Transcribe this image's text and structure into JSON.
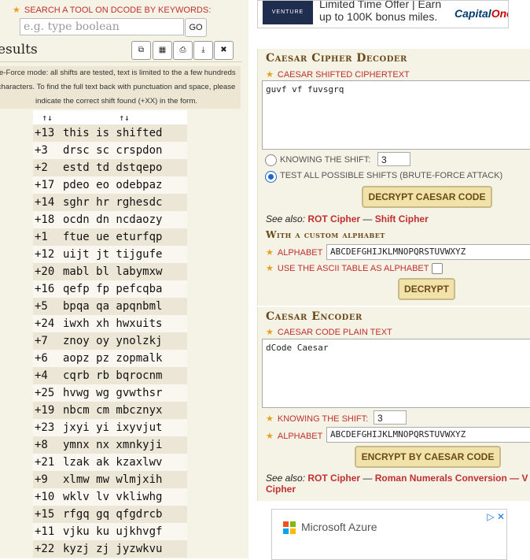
{
  "search": {
    "label": "Search a tool on dCode by keywords:",
    "placeholder": "e.g. type boolean",
    "go_label": "GO"
  },
  "results": {
    "title": "esults",
    "toolbar_icons": [
      "copy-icon",
      "calculator-icon",
      "print-icon",
      "download-icon",
      "close-icon"
    ],
    "toolbar_glyphs": [
      "⧉",
      "▦",
      "⎙",
      "⤓",
      "✖"
    ],
    "note_lines": [
      "te-Force mode: all shifts are tested, text is limited to the a few hundreds",
      "characters. To find the full text back with punctuation and space, please",
      "indicate the correct shift found (+XX) in the form."
    ],
    "sort_header": "↑↓",
    "rows": [
      {
        "shift": "+13",
        "text": "this is shifted"
      },
      {
        "shift": "+3",
        "text": "drsc sc crspdon"
      },
      {
        "shift": "+2",
        "text": "estd td dstqepo"
      },
      {
        "shift": "+17",
        "text": "pdeo eo odebpaz"
      },
      {
        "shift": "+14",
        "text": "sghr hr rghesdc"
      },
      {
        "shift": "+18",
        "text": "ocdn dn ncdaozy"
      },
      {
        "shift": "+1",
        "text": "ftue ue eturfqp"
      },
      {
        "shift": "+12",
        "text": "uijt jt tijgufe"
      },
      {
        "shift": "+20",
        "text": "mabl bl labymxw"
      },
      {
        "shift": "+16",
        "text": "qefp fp pefcqba"
      },
      {
        "shift": "+5",
        "text": "bpqa qa apqnbml"
      },
      {
        "shift": "+24",
        "text": "iwxh xh hwxuits"
      },
      {
        "shift": "+7",
        "text": "znoy oy ynolzkj"
      },
      {
        "shift": "+6",
        "text": "aopz pz zopmalk"
      },
      {
        "shift": "+4",
        "text": "cqrb rb bqrocnm"
      },
      {
        "shift": "+25",
        "text": "hvwg wg gvwthsr"
      },
      {
        "shift": "+19",
        "text": "nbcm cm mbcznyx"
      },
      {
        "shift": "+23",
        "text": "jxyi yi ixyvjut"
      },
      {
        "shift": "+8",
        "text": "ymnx nx xmnkyji"
      },
      {
        "shift": "+21",
        "text": "lzak ak kzaxlwv"
      },
      {
        "shift": "+9",
        "text": "xlmw mw wlmjxih"
      },
      {
        "shift": "+10",
        "text": "wklv lv vkliwhg"
      },
      {
        "shift": "+15",
        "text": "rfgq gq qfgdrcb"
      },
      {
        "shift": "+11",
        "text": "vjku ku ujkhvgf"
      },
      {
        "shift": "+22",
        "text": "kyzj zj jyzwkvu"
      }
    ]
  },
  "ad_top": {
    "brand_card": "VENTURE",
    "line1": "Limited Time Offer | Earn",
    "line2": "up to 100K bonus miles.",
    "logo_a": "Capital",
    "logo_b": "One"
  },
  "decoder": {
    "title": "Caesar Cipher Decoder",
    "ciphertext_label": "Caesar shifted ciphertext",
    "ciphertext_value": "guvf vf fuvsgrq",
    "knowing_shift_label": "Knowing the shift:",
    "shift_value": "3",
    "bruteforce_label": "Test all possible shifts (brute-force attack)",
    "decrypt_button": "Decrypt Caesar Code",
    "see_also_prefix": "See also:",
    "see_also_link1": "ROT Cipher",
    "see_also_sep": "—",
    "see_also_link2": "Shift Cipher",
    "custom_alpha_title": "With a custom alphabet",
    "alphabet_label": "Alphabet",
    "alphabet_value": "ABCDEFGHIJKLMNOPQRSTUVWXYZ",
    "ascii_label": "Use the ASCII table as alphabet",
    "decrypt2_button": "Decrypt"
  },
  "encoder": {
    "title": "Caesar Encoder",
    "plaintext_label": "Caesar code plain text",
    "plaintext_value": "dCode Caesar",
    "knowing_shift_label": "Knowing the shift:",
    "shift_value": "3",
    "alphabet_label": "Alphabet",
    "alphabet_value": "ABCDEFGHIJKLMNOPQRSTUVWXYZ",
    "encrypt_button": "Encrypt by Caesar Code",
    "see_also_prefix": "See also:",
    "see_also_link1": "ROT Cipher",
    "see_also_sep": "—",
    "see_also_link2": "Roman Numerals Conversion",
    "see_also_sep2": "— V",
    "see_also_link3": "Cipher"
  },
  "ad_bottom": {
    "brand": "Microsoft Azure",
    "controls": "▷ ✕"
  },
  "colors": {
    "panel_bg": "#f5f2e6",
    "label_red": "#c03030",
    "title_brown": "#6b4a1a",
    "button_gold": "#f0e2a8",
    "row_odd": "#ece6d6"
  }
}
